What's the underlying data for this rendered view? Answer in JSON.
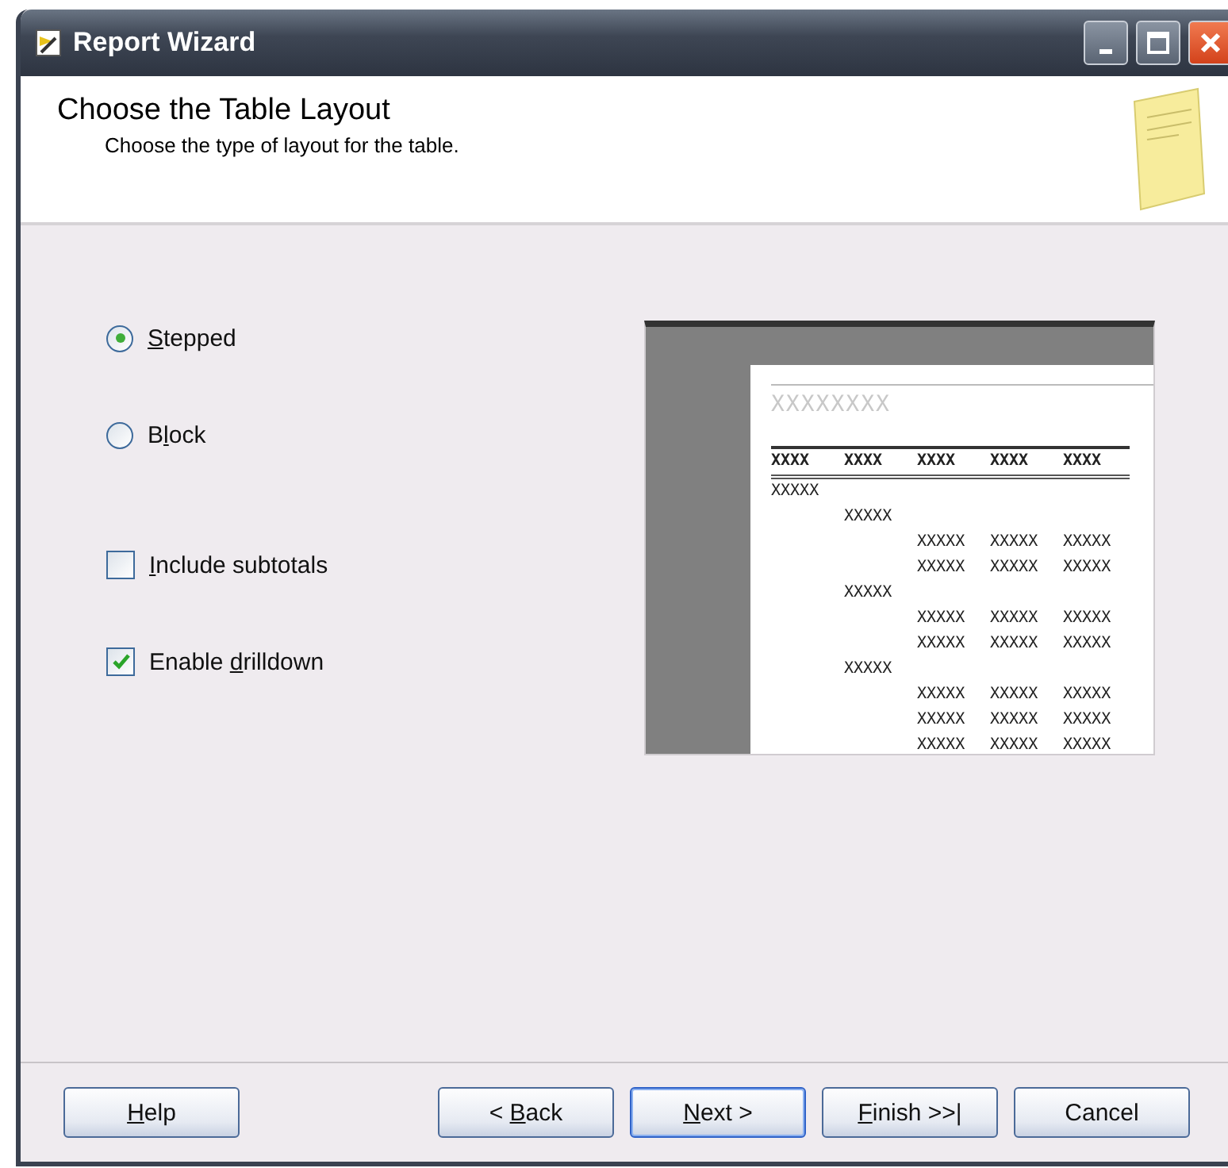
{
  "window": {
    "title": "Report Wizard"
  },
  "header": {
    "title": "Choose the Table Layout",
    "subtitle": "Choose the type of layout for the table."
  },
  "layout_options": [
    {
      "kind": "radio",
      "key": "S",
      "after": "tepped",
      "selected": true
    },
    {
      "kind": "radio",
      "before": "B",
      "key": "l",
      "after": "ock",
      "selected": false
    }
  ],
  "options": [
    {
      "kind": "checkbox",
      "key": "I",
      "after": "nclude subtotals",
      "checked": false
    },
    {
      "kind": "checkbox",
      "before": "Enable ",
      "key": "d",
      "after": "rilldown",
      "checked": true
    }
  ],
  "preview": {
    "title": "XXXXXXXX",
    "columns": [
      "XXXX",
      "XXXX",
      "XXXX",
      "XXXX",
      "XXXX"
    ],
    "rows": [
      {
        "cells": [
          "XXXXX"
        ],
        "children": [
          {
            "cells": [
              "XXXXX"
            ],
            "children": [
              {
                "cells": [
                  "XXXXX",
                  "XXXXX",
                  "XXXXX"
                ]
              },
              {
                "cells": [
                  "XXXXX",
                  "XXXXX",
                  "XXXXX"
                ]
              }
            ]
          },
          {
            "cells": [
              "XXXXX"
            ],
            "children": [
              {
                "cells": [
                  "XXXXX",
                  "XXXXX",
                  "XXXXX"
                ]
              },
              {
                "cells": [
                  "XXXXX",
                  "XXXXX",
                  "XXXXX"
                ]
              }
            ]
          },
          {
            "cells": [
              "XXXXX"
            ],
            "children": [
              {
                "cells": [
                  "XXXXX",
                  "XXXXX",
                  "XXXXX"
                ]
              },
              {
                "cells": [
                  "XXXXX",
                  "XXXXX",
                  "XXXXX"
                ]
              },
              {
                "cells": [
                  "XXXXX",
                  "XXXXX",
                  "XXXXX"
                ]
              }
            ]
          }
        ]
      }
    ]
  },
  "buttons": [
    {
      "kind": "left",
      "key": "H",
      "after": "elp",
      "default": false
    },
    {
      "kind": "right",
      "before": "< ",
      "key": "B",
      "after": "ack",
      "default": false
    },
    {
      "kind": "right",
      "key": "N",
      "after": "ext >",
      "default": true
    },
    {
      "kind": "right",
      "key": "F",
      "after": "inish >>|",
      "default": false
    },
    {
      "kind": "right",
      "before": "Cancel",
      "default": false
    }
  ]
}
